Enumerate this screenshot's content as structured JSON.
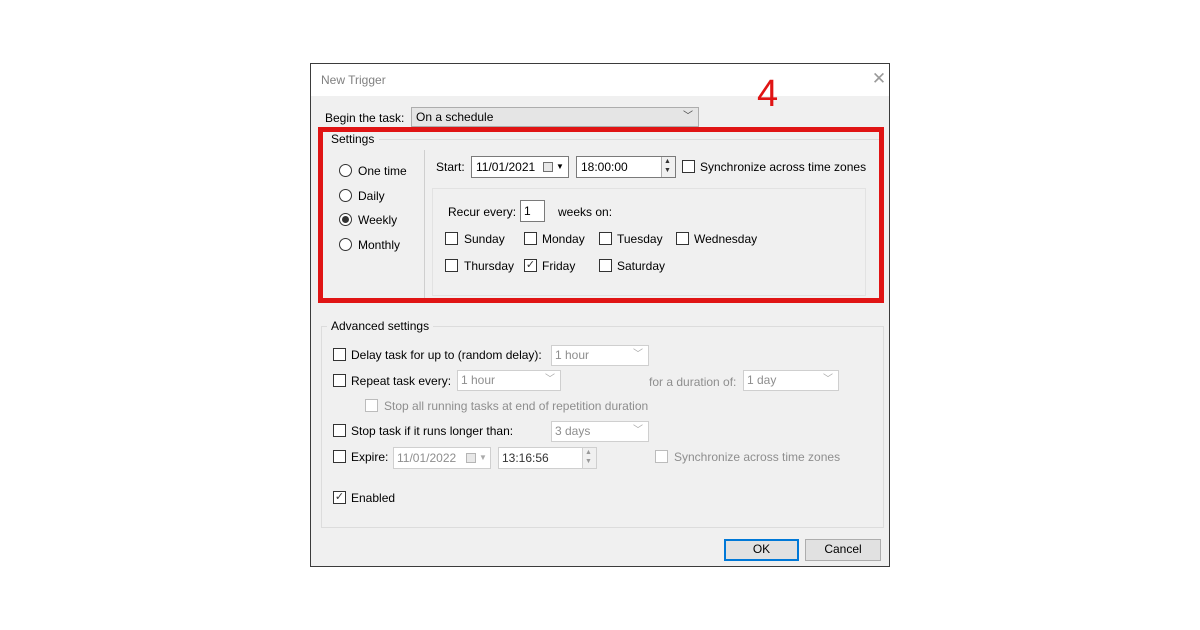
{
  "dialog": {
    "title": "New Trigger"
  },
  "begin": {
    "label": "Begin the task:",
    "value": "On a schedule"
  },
  "annotation": {
    "number": "4",
    "color": "#e01414"
  },
  "settings": {
    "title": "Settings",
    "types": [
      "One time",
      "Daily",
      "Weekly",
      "Monthly"
    ],
    "selected_type": "Weekly",
    "start_label": "Start:",
    "start_date": "11/01/2021",
    "start_time": "18:00:00",
    "sync_label": "Synchronize across time zones",
    "recur_label": "Recur every:",
    "recur_value": "1",
    "weeks_on_label": "weeks on:",
    "days": [
      "Sunday",
      "Monday",
      "Tuesday",
      "Wednesday",
      "Thursday",
      "Friday",
      "Saturday"
    ],
    "checked_days": [
      "Friday"
    ]
  },
  "advanced": {
    "title": "Advanced settings",
    "delay_label": "Delay task for up to (random delay):",
    "delay_value": "1 hour",
    "repeat_label": "Repeat task every:",
    "repeat_value": "1 hour",
    "duration_label": "for a duration of:",
    "duration_value": "1 day",
    "stop_all_label": "Stop all running tasks at end of repetition duration",
    "stop_label": "Stop task if it runs longer than:",
    "stop_value": "3 days",
    "expire_label": "Expire:",
    "expire_date": "11/01/2022",
    "expire_time": "13:16:56",
    "expire_sync_label": "Synchronize across time zones",
    "enabled_label": "Enabled",
    "enabled": true
  },
  "buttons": {
    "ok": "OK",
    "cancel": "Cancel"
  }
}
